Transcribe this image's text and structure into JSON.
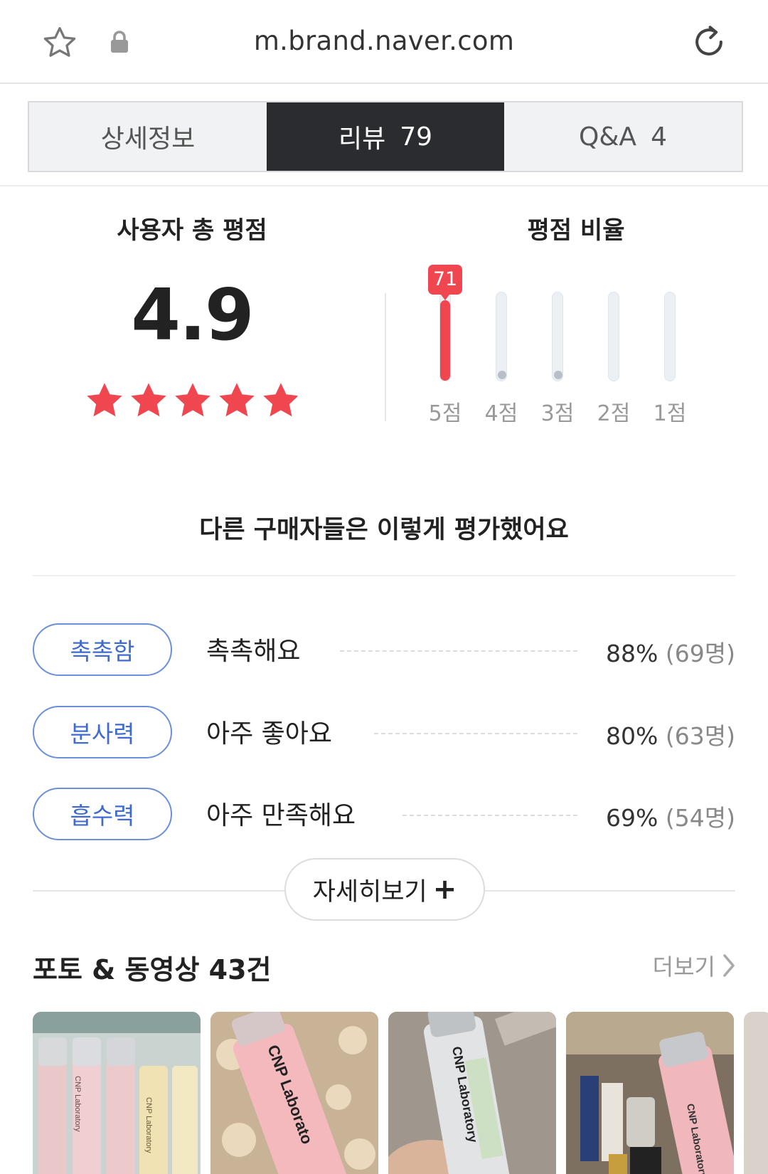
{
  "browser": {
    "url": "m.brand.naver.com"
  },
  "tabs": [
    {
      "label": "상세정보",
      "count": ""
    },
    {
      "label": "리뷰",
      "count": "79"
    },
    {
      "label": "Q&A",
      "count": "4"
    }
  ],
  "rating": {
    "total_title": "사용자 총 평점",
    "score": "4.9",
    "stars_filled_fraction": 0.98,
    "ratio_title": "평점 비율",
    "distribution": [
      {
        "label": "5점",
        "fraction": 0.9,
        "badge": "71"
      },
      {
        "label": "4점",
        "fraction": 0.05,
        "badge": ""
      },
      {
        "label": "3점",
        "fraction": 0.05,
        "badge": ""
      },
      {
        "label": "2점",
        "fraction": 0,
        "badge": ""
      },
      {
        "label": "1점",
        "fraction": 0,
        "badge": ""
      }
    ],
    "colors": {
      "accent": "#f0464f",
      "track": "#eceff3"
    }
  },
  "evaluation": {
    "title": "다른 구매자들은 이렇게 평가했어요",
    "rows": [
      {
        "tag": "촉촉함",
        "answer": "촉촉해요",
        "percent": "88%",
        "count": "(69명)"
      },
      {
        "tag": "분사력",
        "answer": "아주 좋아요",
        "percent": "80%",
        "count": "(63명)"
      },
      {
        "tag": "흡수력",
        "answer": "아주 만족해요",
        "percent": "69%",
        "count": "(54명)"
      }
    ],
    "more_label": "자세히보기",
    "more_plus": "+"
  },
  "photos": {
    "title": "포토 & 동영상 43건",
    "more_label": "더보기",
    "thumbnails": [
      {
        "brand_text": "CNP Laboratory"
      },
      {
        "brand_text": "CNP Laborato"
      },
      {
        "brand_text": "CNP Laboratory"
      },
      {
        "brand_text": "CNP Laboratory"
      }
    ]
  }
}
